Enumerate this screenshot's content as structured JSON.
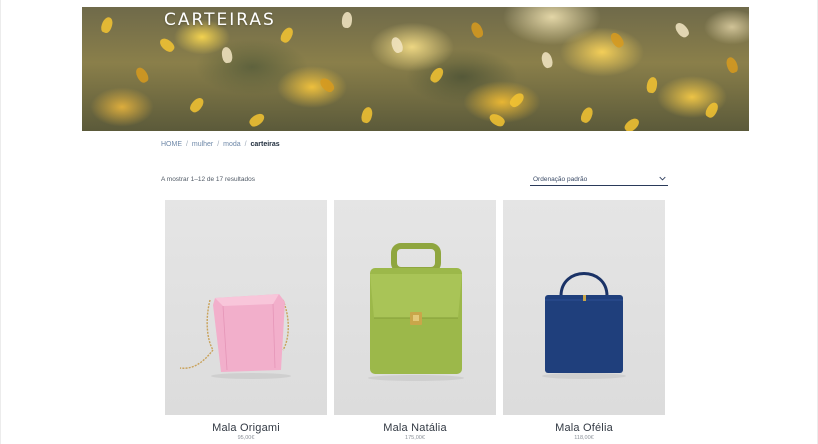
{
  "hero": {
    "title": "CARTEIRAS"
  },
  "breadcrumb": {
    "items": [
      {
        "label": "HOME"
      },
      {
        "label": "mulher"
      },
      {
        "label": "moda"
      }
    ],
    "separator": "/",
    "current": "carteiras"
  },
  "results": {
    "count_text": "A mostrar 1–12 de 17 resultados"
  },
  "sort": {
    "selected": "Ordenação padrão",
    "icon": "chevron-down-icon"
  },
  "products": [
    {
      "name": "Mala Origami",
      "price": "95,00€",
      "color": "#f2afcb"
    },
    {
      "name": "Mala Natália",
      "price": "175,00€",
      "color": "#9cb84a"
    },
    {
      "name": "Mala Ofélia",
      "price": "118,00€",
      "color": "#1f3f7c"
    }
  ],
  "colors": {
    "link": "#6e88a8",
    "text_dark": "#1c2a3a",
    "accent_underline": "#2a3a5a"
  }
}
